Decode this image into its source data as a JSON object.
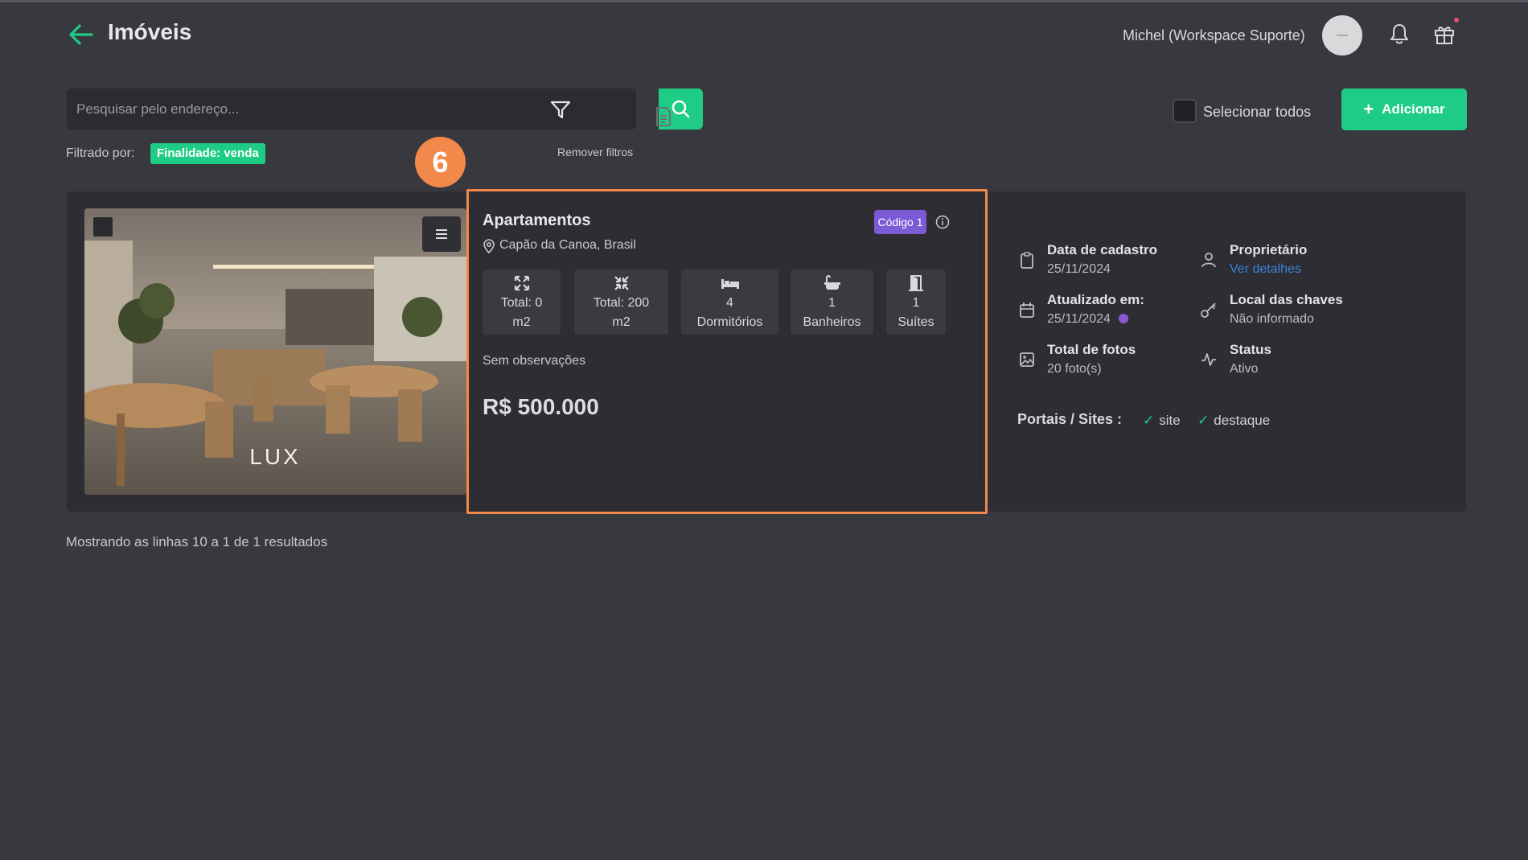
{
  "header": {
    "title": "Imóveis",
    "user_name": "Michel (Workspace Suporte)"
  },
  "search": {
    "placeholder": "Pesquisar pelo endereço..."
  },
  "toolbar": {
    "select_all_label": "Selecionar todos",
    "add_label": "Adicionar"
  },
  "filters": {
    "prefix": "Filtrado por:",
    "active": "Finalidade: venda",
    "remove_label": "Remover filtros"
  },
  "step_badge": "6",
  "property": {
    "photo_watermark": "LUX",
    "type": "Apartamentos",
    "location": "Capão da Canoa, Brasil",
    "code": "Código 1",
    "features": [
      {
        "icon": "expand-icon",
        "value": "Total: 0",
        "label": "m2"
      },
      {
        "icon": "collapse-icon",
        "value": "Total: 200",
        "label": "m2"
      },
      {
        "icon": "bed-icon",
        "value": "4",
        "label": "Dormitórios"
      },
      {
        "icon": "bathtub-icon",
        "value": "1",
        "label": "Banheiros"
      },
      {
        "icon": "door-icon",
        "value": "1",
        "label": "Suítes"
      }
    ],
    "observations": "Sem observações",
    "price": "R$ 500.000"
  },
  "details": {
    "created_label": "Data de cadastro",
    "created_value": "25/11/2024",
    "owner_label": "Proprietário",
    "owner_link": "Ver detalhes",
    "updated_label": "Atualizado em:",
    "updated_value": "25/11/2024",
    "keys_label": "Local das chaves",
    "keys_value": "Não informado",
    "photos_label": "Total de fotos",
    "photos_value": "20 foto(s)",
    "status_label": "Status",
    "status_value": "Ativo",
    "portals_label": "Portais / Sites :",
    "portals": [
      "site",
      "destaque"
    ]
  },
  "footer": {
    "results_text": "Mostrando as linhas 10 a 1 de 1 resultados"
  },
  "colors": {
    "background": "#38383f",
    "card": "#2d2d33",
    "accent_green": "#1fcc86",
    "highlight_orange": "#f2894a",
    "code_purple": "#7c5ad6",
    "link_blue": "#3b82d6"
  }
}
